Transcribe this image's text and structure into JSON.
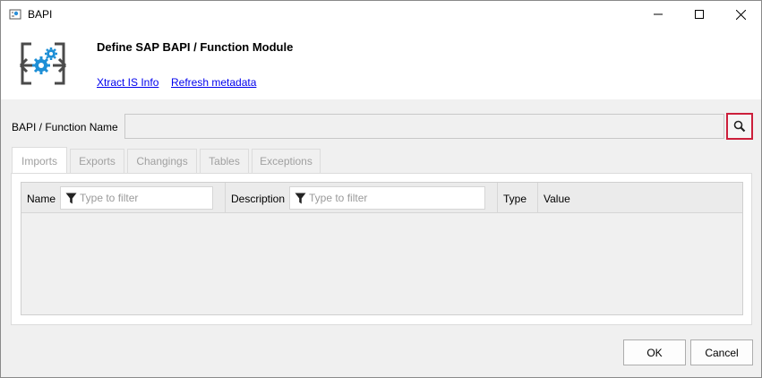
{
  "window": {
    "title": "BAPI",
    "app_icon": "bapi-app-icon"
  },
  "controls": {
    "minimize_icon": "minimize-icon",
    "maximize_icon": "maximize-icon",
    "close_icon": "close-icon"
  },
  "header": {
    "title": "Define SAP BAPI / Function Module",
    "icon": "gears-arrows-icon",
    "links": [
      "Xtract IS Info",
      "Refresh metadata"
    ]
  },
  "function": {
    "label": "BAPI / Function Name",
    "value": "",
    "search_icon": "search-icon",
    "highlight_color": "#cc1f3b"
  },
  "tabs": [
    "Imports",
    "Exports",
    "Changings",
    "Tables",
    "Exceptions"
  ],
  "active_tab": "Imports",
  "grid": {
    "columns": [
      {
        "label": "Name",
        "filter_placeholder": "Type to filter"
      },
      {
        "label": "Description",
        "filter_placeholder": "Type to filter"
      },
      {
        "label": "Type"
      },
      {
        "label": "Value"
      }
    ],
    "rows": []
  },
  "buttons": {
    "ok": "OK",
    "cancel": "Cancel"
  }
}
